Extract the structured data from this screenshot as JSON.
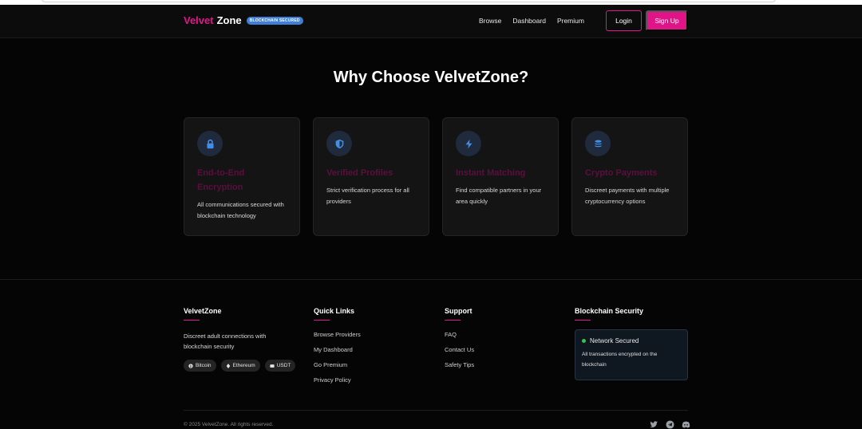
{
  "brand": {
    "part1": "Velvet",
    "part2": "Zone",
    "badge": "BLOCKCHAIN SECURED"
  },
  "nav": {
    "links": [
      "Browse",
      "Dashboard",
      "Premium"
    ],
    "login_label": "Login",
    "signup_label": "Sign Up"
  },
  "features": {
    "title": "Why Choose VelvetZone?",
    "cards": [
      {
        "icon": "lock-icon",
        "title": "End-to-End Encryption",
        "desc": "All communications secured with blockchain technology"
      },
      {
        "icon": "shield-icon",
        "title": "Verified Profiles",
        "desc": "Strict verification process for all providers"
      },
      {
        "icon": "bolt-icon",
        "title": "Instant Matching",
        "desc": "Find compatible partners in your area quickly"
      },
      {
        "icon": "coins-icon",
        "title": "Crypto Payments",
        "desc": "Discreet payments with multiple cryptocurrency options"
      }
    ]
  },
  "footer": {
    "about": {
      "heading": "VelvetZone",
      "desc": "Discreet adult connections with blockchain security",
      "chips": [
        "Bitcoin",
        "Ethereum",
        "USDT"
      ]
    },
    "quick_links": {
      "heading": "Quick Links",
      "items": [
        "Browse Providers",
        "My Dashboard",
        "Go Premium",
        "Privacy Policy"
      ]
    },
    "support": {
      "heading": "Support",
      "items": [
        "FAQ",
        "Contact Us",
        "Safety Tips"
      ]
    },
    "security": {
      "heading": "Blockchain Security",
      "status": "Network Secured",
      "text": "All transactions encrypted on the blockchain"
    },
    "copyright": "© 2025 VelvetZone. All rights reserved.",
    "socials": [
      "twitter-icon",
      "telegram-icon",
      "discord-icon"
    ]
  },
  "colors": {
    "accent": "#e5148c",
    "badge": "#3f7fd8",
    "icon": "#3f8ee8",
    "status": "#39c24a"
  }
}
